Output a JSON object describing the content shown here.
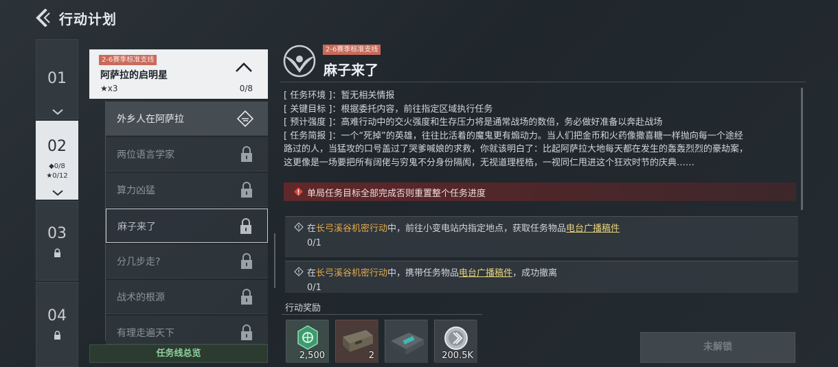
{
  "header": {
    "title": "行动计划",
    "back_icon": "back-arrow-icon"
  },
  "chapters": [
    {
      "num": "01",
      "state": "collapsed",
      "chevron": "chevron-down-icon"
    },
    {
      "num": "02",
      "state": "active",
      "diamond": "◆0/8",
      "stars": "★0/12",
      "chevron": "chevron-down-icon"
    },
    {
      "num": "03",
      "state": "locked",
      "icon": "lock-icon"
    },
    {
      "num": "04",
      "state": "locked",
      "icon": "lock-icon"
    }
  ],
  "task_line": {
    "tag": "2-6赛季标准支线",
    "name": "阿萨拉的启明星",
    "stars": "★x3",
    "progress": "0/8",
    "items": [
      {
        "label": "外乡人在阿萨拉",
        "icon": "diamond-map-icon"
      },
      {
        "label": "两位语言学家",
        "icon": "lock-icon"
      },
      {
        "label": "算力凶猛",
        "icon": "lock-icon"
      },
      {
        "label": "麻子来了",
        "icon": "lock-icon"
      },
      {
        "label": "分几步走?",
        "icon": "lock-icon"
      },
      {
        "label": "战术的根源",
        "icon": "lock-icon"
      },
      {
        "label": "有理走遍天下",
        "icon": "lock-icon"
      }
    ],
    "overview_label": "任务线总览"
  },
  "detail": {
    "tag": "2-6赛季标准支线",
    "title": "麻子来了",
    "emblem_icon": "eagle-emblem-icon",
    "info": [
      {
        "key": "[ 任务环境 ]：",
        "value": "暂无相关情报"
      },
      {
        "key": "[ 关键目标 ]：",
        "value": "根据委托内容，前往指定区域执行任务"
      },
      {
        "key": "[ 预计强度 ]：",
        "value": "高难行动中的交火强度和生存压力将是通常战场的数倍，务必做好准备以奔赴战场"
      },
      {
        "key": "[ 任务简报 ]：",
        "value": "一个“死掉”的英雄，往往比活着的魔鬼更有煽动力。当人们把金币和火药像撒喜糖一样抛向每一个途经"
      }
    ],
    "info_extra": [
      "路过的人，当猛攻的口号盖过了哭爹喊娘的求救，你就该明白了：比起阿萨拉大地每天都在发生的轰轰烈烈的豪劫案，",
      "这更像是一场要把所有阔佬与穷鬼不分身份隔阂，无视道理桎梏，一视同仁甩进这个狂欢时节的庆典……"
    ],
    "warning": "单局任务目标全部完成否则重置整个任务进度",
    "objectives": [
      {
        "pre": "在",
        "place": "长弓溪谷机密行动",
        "mid": "中，前往小变电站内指定地点，获取任务物品",
        "item": "电台广播稿件",
        "post": "",
        "count": "0/1"
      },
      {
        "pre": "在",
        "place": "长弓溪谷机密行动",
        "mid": "中，携带任务物品",
        "item": "电台广播稿件",
        "post": "，成功撤离",
        "count": "0/1"
      }
    ]
  },
  "rewards": {
    "title": "行动奖励",
    "items": [
      {
        "name": "green-badge-icon",
        "amount": "2,500"
      },
      {
        "name": "ammo-crate-icon",
        "amount": "2"
      },
      {
        "name": "device-case-icon",
        "amount": ""
      },
      {
        "name": "silver-coin-icon",
        "amount": "200.5K"
      }
    ]
  },
  "unlock_button": "未解锁"
}
